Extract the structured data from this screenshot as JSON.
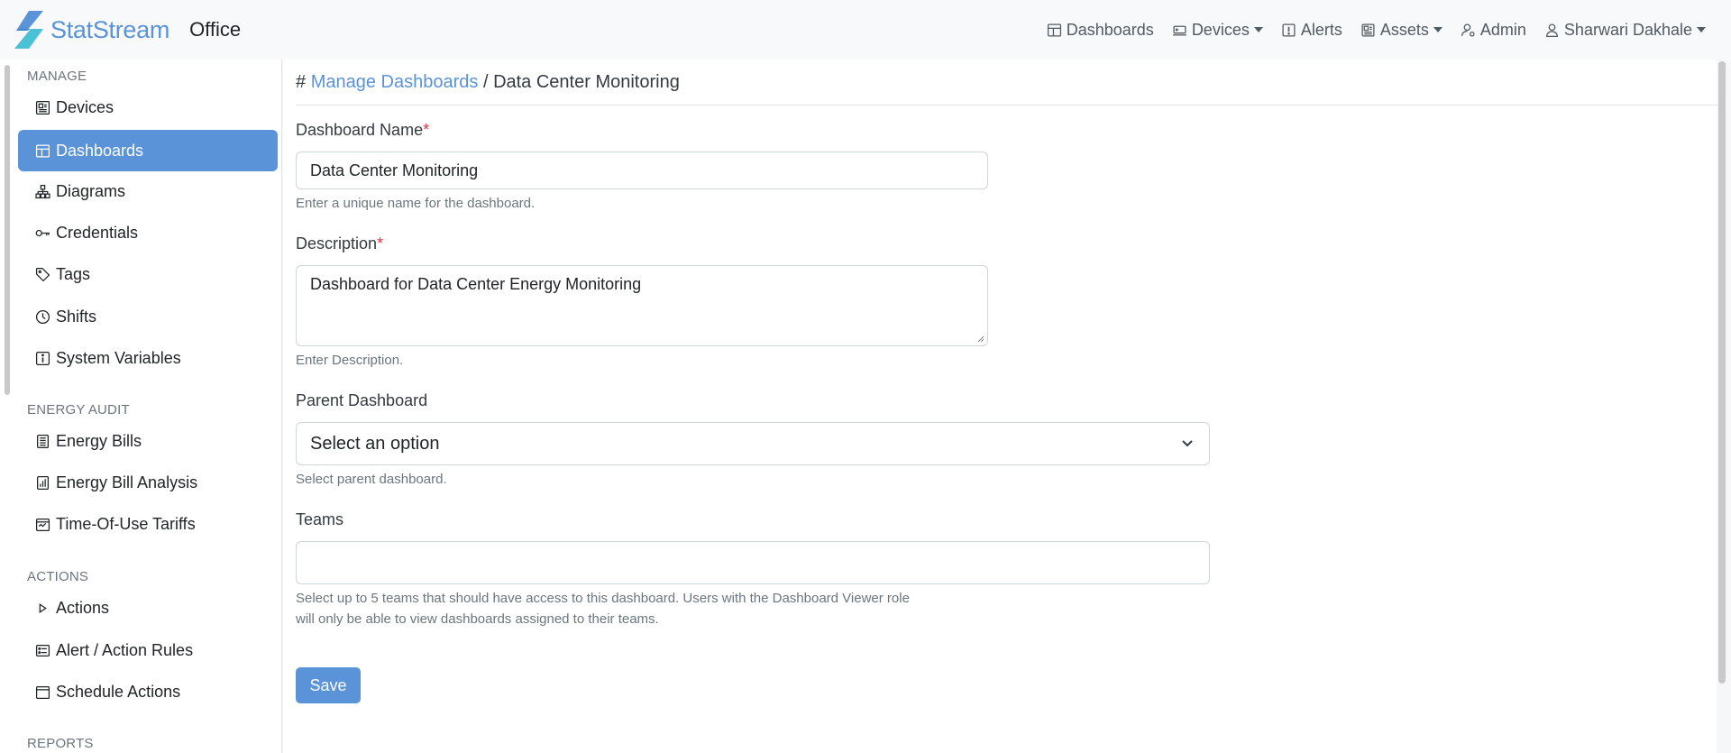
{
  "header": {
    "brand_name": "StatStream",
    "org_name": "Office",
    "nav": [
      {
        "label": "Dashboards",
        "icon": "dashboard-icon"
      },
      {
        "label": "Devices",
        "icon": "devices-icon",
        "dropdown": true
      },
      {
        "label": "Alerts",
        "icon": "alert-icon"
      },
      {
        "label": "Assets",
        "icon": "assets-icon",
        "dropdown": true
      },
      {
        "label": "Admin",
        "icon": "admin-icon"
      },
      {
        "label": "Sharwari Dakhale",
        "icon": "user-icon",
        "dropdown": true
      }
    ]
  },
  "sidebar": {
    "sections": {
      "manage": "MANAGE",
      "energy_audit": "ENERGY AUDIT",
      "actions": "ACTIONS",
      "reports": "REPORTS"
    },
    "items": [
      {
        "label": "Devices",
        "icon": "devices-icon"
      },
      {
        "label": "Dashboards",
        "icon": "dashboard-icon",
        "active": true
      },
      {
        "label": "Diagrams",
        "icon": "diagram-icon"
      },
      {
        "label": "Credentials",
        "icon": "key-icon"
      },
      {
        "label": "Tags",
        "icon": "tags-icon"
      },
      {
        "label": "Shifts",
        "icon": "clock-icon"
      },
      {
        "label": "System Variables",
        "icon": "info-icon"
      },
      {
        "label": "Energy Bills",
        "icon": "bill-icon"
      },
      {
        "label": "Energy Bill Analysis",
        "icon": "bar-chart-icon"
      },
      {
        "label": "Time-Of-Use Tariffs",
        "icon": "calendar-icon"
      },
      {
        "label": "Actions",
        "icon": "play-icon"
      },
      {
        "label": "Alert / Action Rules",
        "icon": "rules-icon"
      },
      {
        "label": "Schedule Actions",
        "icon": "calendar-icon"
      }
    ]
  },
  "breadcrumb": {
    "hash": "#",
    "link": "Manage Dashboards",
    "separator": "/",
    "current": "Data Center Monitoring"
  },
  "form": {
    "name_label": "Dashboard Name",
    "name_value": "Data Center Monitoring",
    "name_help": "Enter a unique name for the dashboard.",
    "description_label": "Description",
    "description_value": "Dashboard for Data Center Energy Monitoring",
    "description_help": "Enter Description.",
    "parent_label": "Parent Dashboard",
    "parent_value": "Select an option",
    "parent_help": "Select parent dashboard.",
    "teams_label": "Teams",
    "teams_value": "",
    "teams_help_line1": "Select up to 5 teams that should have access to this dashboard. Users with the Dashboard Viewer role",
    "teams_help_line2": "will only be able to view dashboards assigned to their teams.",
    "required_mark": "*",
    "save_label": "Save"
  },
  "colors": {
    "accent": "#5b93d9",
    "required": "#dc3545"
  }
}
